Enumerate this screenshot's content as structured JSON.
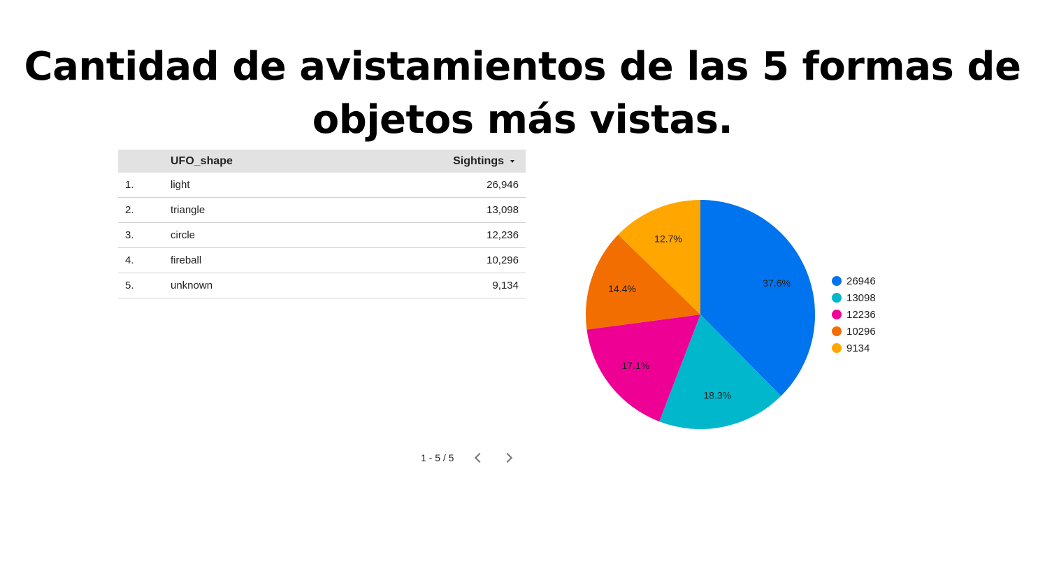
{
  "title": "Cantidad de avistamientos de las 5 formas de objetos más vistas.",
  "table": {
    "headers": {
      "shape": "UFO_shape",
      "sightings": "Sightings"
    },
    "sort_icon": "sort-descending-icon",
    "rows": [
      {
        "index": "1.",
        "shape": "light",
        "value": "26,946"
      },
      {
        "index": "2.",
        "shape": "triangle",
        "value": "13,098"
      },
      {
        "index": "3.",
        "shape": "circle",
        "value": "12,236"
      },
      {
        "index": "4.",
        "shape": "fireball",
        "value": "10,296"
      },
      {
        "index": "5.",
        "shape": "unknown",
        "value": "9,134"
      }
    ]
  },
  "pager": {
    "text": "1 - 5 / 5",
    "prev_icon": "chevron-left-icon",
    "next_icon": "chevron-right-icon"
  },
  "chart_data": {
    "type": "pie",
    "categories": [
      "26946",
      "13098",
      "12236",
      "10296",
      "9134"
    ],
    "values": [
      26946,
      13098,
      12236,
      10296,
      9134
    ],
    "percent_labels": [
      "37.6%",
      "18.3%",
      "17.1%",
      "14.4%",
      "12.7%"
    ],
    "colors": [
      "#0073ee",
      "#00b7cc",
      "#ee0094",
      "#f26e00",
      "#ffa600"
    ],
    "legend_position": "right",
    "start_angle": "12 o'clock, clockwise"
  }
}
